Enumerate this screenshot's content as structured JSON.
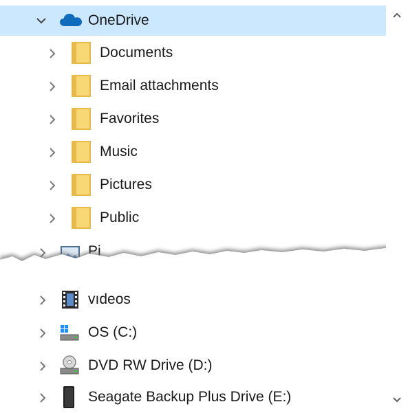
{
  "tree": {
    "root": {
      "label": "OneDrive",
      "icon": "onedrive-cloud-icon",
      "expanded": true
    },
    "folders": [
      {
        "label": "Documents"
      },
      {
        "label": "Email attachments"
      },
      {
        "label": "Favorites"
      },
      {
        "label": "Music"
      },
      {
        "label": "Pictures"
      },
      {
        "label": "Public"
      }
    ],
    "partial_item": {
      "label": "Pi",
      "icon": "pictures-library-icon"
    },
    "items": [
      {
        "label": "ᴠıdeos",
        "icon": "videos-library-icon"
      },
      {
        "label": "OS (C:)",
        "icon": "windows-drive-icon"
      },
      {
        "label": "DVD RW Drive (D:)",
        "icon": "dvd-drive-icon"
      },
      {
        "label": "Seagate Backup Plus Drive (E:)",
        "icon": "external-drive-icon"
      }
    ]
  },
  "colors": {
    "selection": "#cce8ff",
    "folder": "#f8d775",
    "folder_dark": "#e9b949",
    "cloud": "#0f6cbd"
  }
}
